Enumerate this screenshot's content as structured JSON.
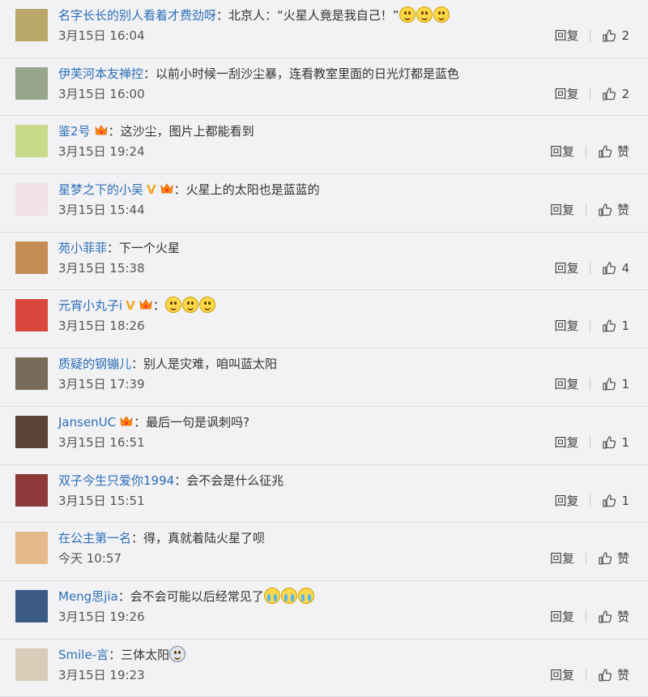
{
  "comments": [
    {
      "user": "名字长长的别人看着才费劲呀",
      "badge_v": false,
      "badge_vip": false,
      "text": "北京人：“火星人竟是我自己！”",
      "emojis": [
        "smile",
        "smile",
        "smile"
      ],
      "time": "3月15日 16:04",
      "reply": "回复",
      "likes": "2",
      "avatar_color": "#b9a86a"
    },
    {
      "user": "伊芙河本友禅控",
      "badge_v": false,
      "badge_vip": false,
      "text": "以前小时候一刮沙尘暴，连看教室里面的日光灯都是蓝色",
      "emojis": [],
      "time": "3月15日 16:00",
      "reply": "回复",
      "likes": "2",
      "avatar_color": "#9aa58e"
    },
    {
      "user": "鉴2号",
      "badge_v": false,
      "badge_vip": true,
      "text": "这沙尘，图片上都能看到",
      "emojis": [],
      "time": "3月15日 19:24",
      "reply": "回复",
      "likes": "赞",
      "avatar_color": "#c9d98a"
    },
    {
      "user": "星梦之下的小吴",
      "badge_v": true,
      "badge_vip": true,
      "text": "火星上的太阳也是蓝蓝的",
      "emojis": [],
      "time": "3月15日 15:44",
      "reply": "回复",
      "likes": "赞",
      "avatar_color": "#f1e2e6"
    },
    {
      "user": "苑小菲菲",
      "badge_v": false,
      "badge_vip": false,
      "text": "下一个火星",
      "emojis": [],
      "time": "3月15日 15:38",
      "reply": "回复",
      "likes": "4",
      "avatar_color": "#c38c52"
    },
    {
      "user": "元宵小丸子i",
      "badge_v": true,
      "badge_vip": true,
      "text": "",
      "emojis": [
        "smile",
        "smile",
        "smile"
      ],
      "time": "3月15日 18:26",
      "reply": "回复",
      "likes": "1",
      "avatar_color": "#d9463b"
    },
    {
      "user": "质疑的钢镚儿",
      "badge_v": false,
      "badge_vip": false,
      "text": "别人是灾难，咱叫蓝太阳",
      "emojis": [],
      "time": "3月15日 17:39",
      "reply": "回复",
      "likes": "1",
      "avatar_color": "#7a6a5a"
    },
    {
      "user": "JansenUC",
      "badge_v": false,
      "badge_vip": true,
      "text": "最后一句是讽刺吗?",
      "emojis": [],
      "time": "3月15日 16:51",
      "reply": "回复",
      "likes": "1",
      "avatar_color": "#5b4436"
    },
    {
      "user": "双子今生只爱你1994",
      "badge_v": false,
      "badge_vip": false,
      "text": "会不会是什么征兆",
      "emojis": [],
      "time": "3月15日 15:51",
      "reply": "回复",
      "likes": "1",
      "avatar_color": "#8e3a3a"
    },
    {
      "user": "在公主第一名",
      "badge_v": false,
      "badge_vip": false,
      "text": "得，真就着陆火星了呗",
      "emojis": [],
      "time": "今天 10:57",
      "reply": "回复",
      "likes": "赞",
      "avatar_color": "#e6b98a"
    },
    {
      "user": "Meng思jia",
      "badge_v": false,
      "badge_vip": false,
      "text": "会不会可能以后经常见了",
      "emojis": [
        "cry",
        "cry",
        "cry"
      ],
      "time": "3月15日 19:26",
      "reply": "回复",
      "likes": "赞",
      "avatar_color": "#3b5a86"
    },
    {
      "user": "Smile-言",
      "badge_v": false,
      "badge_vip": false,
      "text": "三体太阳",
      "emojis": [
        "face"
      ],
      "time": "3月15日 19:23",
      "reply": "回复",
      "likes": "赞",
      "avatar_color": "#d9cbb8"
    }
  ],
  "ui": {
    "colon": "："
  }
}
